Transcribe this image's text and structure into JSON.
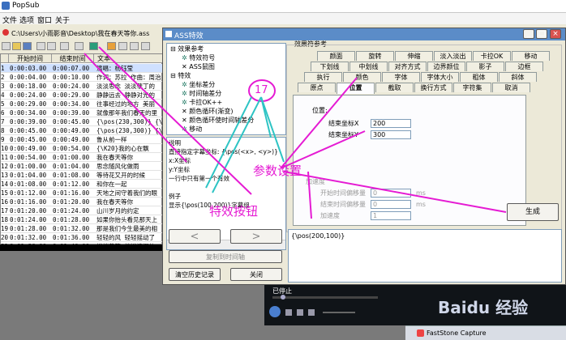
{
  "app": {
    "title": "PopSub"
  },
  "menu": [
    "文件",
    "选项",
    "窗口",
    "关于"
  ],
  "path": "C:\\Users\\小雨影音\\Desktop\\我在春天等你.ass",
  "grid": {
    "headers": [
      "开始时间",
      "结束时间",
      "文本"
    ],
    "rows": [
      {
        "n": "1",
        "s": "0:00:03.00",
        "e": "0:00:07.00",
        "t": "演唱：杨钰莹"
      },
      {
        "n": "2",
        "s": "0:00:04.00",
        "e": "0:00:10.00",
        "t": "作词：苏拉 作曲：周治"
      },
      {
        "n": "3",
        "s": "0:00:18.00",
        "e": "0:00:24.00",
        "t": "淡淡思念 淡淡孽丁的"
      },
      {
        "n": "4",
        "s": "0:00:24.00",
        "e": "0:00:29.00",
        "t": "静静远去 静静对光的"
      },
      {
        "n": "5",
        "s": "0:00:29.00",
        "e": "0:00:34.00",
        "t": "往事经过的地方 美丽"
      },
      {
        "n": "6",
        "s": "0:00:34.00",
        "e": "0:00:39.00",
        "t": "就像那年我们春天的里"
      },
      {
        "n": "7",
        "s": "0:00:39.00",
        "e": "0:00:45.00",
        "t": "{\\pos(230,300)} {\\"
      },
      {
        "n": "8",
        "s": "0:00:45.00",
        "e": "0:00:49.00",
        "t": "{\\pos(230,300)} {\\"
      },
      {
        "n": "9",
        "s": "0:00:45.00",
        "e": "0:00:49.00",
        "t": "鲁从前一样"
      },
      {
        "n": "10",
        "s": "0:00:49.00",
        "e": "0:00:54.00",
        "t": "{\\K20}我的心在飘"
      },
      {
        "n": "11",
        "s": "0:00:54.00",
        "e": "0:01:00.00",
        "t": "我在春天等你"
      },
      {
        "n": "12",
        "s": "0:01:00.00",
        "e": "0:01:04.00",
        "t": "思念随风化做雨"
      },
      {
        "n": "13",
        "s": "0:01:04.00",
        "e": "0:01:08.00",
        "t": "等待花又开的时候"
      },
      {
        "n": "14",
        "s": "0:01:08.00",
        "e": "0:01:12.00",
        "t": "和你在一起"
      },
      {
        "n": "15",
        "s": "0:01:12.00",
        "e": "0:01:16.00",
        "t": "天地之间守着我们的眼"
      },
      {
        "n": "16",
        "s": "0:01:16.00",
        "e": "0:01:20.00",
        "t": "我在春天等你"
      },
      {
        "n": "17",
        "s": "0:01:20.00",
        "e": "0:01:24.00",
        "t": "山川岁月的约定"
      },
      {
        "n": "18",
        "s": "0:01:24.00",
        "e": "0:01:28.00",
        "t": "如果你抬头看见那天上"
      },
      {
        "n": "19",
        "s": "0:01:28.00",
        "e": "0:01:32.00",
        "t": "那是我们今生最美的相"
      },
      {
        "n": "20",
        "s": "0:01:32.00",
        "e": "0:01:36.00",
        "t": "轻轻的风 轻轻摇动了"
      },
      {
        "n": "21",
        "s": "0:01:36.00",
        "e": "0:01:40.00",
        "t": "悄悄恭等 悄悄流泪的"
      }
    ]
  },
  "dialog": {
    "title": "ASS特效",
    "tree": [
      {
        "label": "效果参考",
        "level": 0,
        "icon": "minus"
      },
      {
        "label": "特效符号",
        "level": 1,
        "icon": "gear"
      },
      {
        "label": "ASS鼠图",
        "level": 1,
        "icon": "x"
      },
      {
        "label": "特效",
        "level": 0,
        "icon": "minus"
      },
      {
        "label": "坐标差分",
        "level": 1,
        "icon": "gear"
      },
      {
        "label": "时间轴差分",
        "level": 1,
        "icon": "gear"
      },
      {
        "label": "卡拉OK++",
        "level": 1,
        "icon": "gear"
      },
      {
        "label": "颜色循环(渐变)",
        "level": 1,
        "icon": "x"
      },
      {
        "label": "颜色循环使时间轴差分",
        "level": 1,
        "icon": "x"
      },
      {
        "label": "移动",
        "level": 1,
        "icon": "gear"
      }
    ],
    "desc_lines": [
      "说明",
      "直接指定字幕坐标: {\\pos(<x>, <y>)}",
      "  x:X坐标",
      "  y:Y坐标",
      "一行中只有第一个有效",
      "",
      "例子",
      "显示{\\pos(100,200)}字幕组"
    ],
    "nav": {
      "prev": "<",
      "next": ">"
    },
    "btn_reset": "复制到时间轴",
    "btn_clear": "清空历史记录",
    "btn_close": "关闭",
    "ref_label": "效果符参考",
    "tabs_row1": [
      "颜面",
      "旋转",
      "伸缩",
      "淡入淡出",
      "卡拉OK",
      "移动"
    ],
    "tabs_row2": [
      "下划线",
      "中划线",
      "对齐方式",
      "边界颜位",
      "影子",
      "边框"
    ],
    "tabs_row3": [
      "执行",
      "颜色",
      "字体",
      "字体大小",
      "粗体",
      "斜体"
    ],
    "tabs_row4": [
      "原点",
      "位置",
      "截取",
      "换行方式",
      "字符集",
      "取消"
    ],
    "pos_label": "位置:",
    "end_x_label": "结束坐标X",
    "end_x": "200",
    "end_y_label": "结束坐标Y",
    "end_y": "300",
    "speed_label": "加速度",
    "start_move_label": "开始时间偏移量",
    "start_move": "0",
    "end_move_label": "结束时间偏移量",
    "end_move": "0",
    "accel_label": "加速度",
    "accel": "1",
    "ms1": "ms",
    "ms2": "ms",
    "btn_generate": "生成",
    "output": "{\\pos(200,100)}"
  },
  "annotations": {
    "circle_num": "17",
    "param_label": "参数设置",
    "effect_label": "特效按钮"
  },
  "player": {
    "status": "已停止"
  },
  "taskbar": {
    "app": "FastStone Capture"
  },
  "watermark": "Baidu 经验",
  "colors": {
    "accent": "#e51bd3",
    "title_blue": "#5b8cc8"
  }
}
